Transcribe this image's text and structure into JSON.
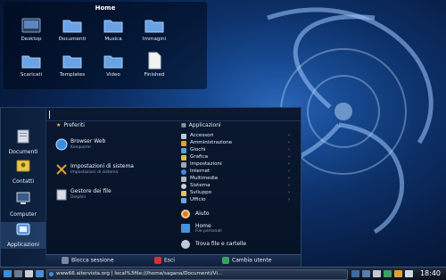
{
  "desktop": {
    "title": "Home",
    "items": [
      {
        "label": "Desktop",
        "icon": "desktop-folder-icon"
      },
      {
        "label": "Documenti",
        "icon": "folder-icon"
      },
      {
        "label": "Musica",
        "icon": "folder-icon"
      },
      {
        "label": "Immagini",
        "icon": "folder-icon"
      },
      {
        "label": "Scaricati",
        "icon": "folder-icon"
      },
      {
        "label": "Templates",
        "icon": "folder-icon"
      },
      {
        "label": "Video",
        "icon": "folder-icon"
      },
      {
        "label": "Finished",
        "icon": "file-icon"
      }
    ]
  },
  "launcher": {
    "sidebar": [
      {
        "label": "Documenti",
        "icon": "documents-icon"
      },
      {
        "label": "Contatti",
        "icon": "contacts-icon"
      },
      {
        "label": "Computer",
        "icon": "computer-icon"
      },
      {
        "label": "Applicazioni",
        "icon": "applications-icon"
      }
    ],
    "favorites_header": "Preferiti",
    "applications_header": "Applicazioni",
    "favorites": [
      {
        "title": "Browser Web",
        "subtitle": "Konqueror",
        "icon": "web-browser-icon"
      },
      {
        "title": "Impostazioni di sistema",
        "subtitle": "Impostazioni di sistema",
        "icon": "settings-icon"
      },
      {
        "title": "Gestore dei file",
        "subtitle": "Dolphin",
        "icon": "file-manager-icon"
      }
    ],
    "categories": [
      {
        "label": "Accessori",
        "color": "#c0c8d4"
      },
      {
        "label": "Amministrazione",
        "color": "#e0a030"
      },
      {
        "label": "Giochi",
        "color": "#5aa0e0"
      },
      {
        "label": "Grafica",
        "color": "#d8c040"
      },
      {
        "label": "Impostazioni",
        "color": "#9fa8b4"
      },
      {
        "label": "Internet",
        "color": "#3a8ee0"
      },
      {
        "label": "Multimedia",
        "color": "#b0b8c4"
      },
      {
        "label": "Sistema",
        "color": "#c8d0da"
      },
      {
        "label": "Sviluppo",
        "color": "#e0c060"
      },
      {
        "label": "Ufficio",
        "color": "#6aa8e8"
      }
    ],
    "arrow": "›",
    "extra": [
      {
        "title": "Aiuto",
        "subtitle": "",
        "icon": "help-icon",
        "color": "#e07a20"
      },
      {
        "title": "Home",
        "subtitle": "File personali",
        "icon": "home-icon",
        "color": "#4a90d8"
      },
      {
        "title": "Trova file e cartelle",
        "subtitle": "",
        "icon": "find-icon",
        "color": "#c0c8d4"
      }
    ],
    "bottom": {
      "lock": "Blocca sessione",
      "logout": "Esci",
      "switch": "Cambia utente"
    }
  },
  "taskbar": {
    "task_title": "www66.altervista.org | local%3file:///home/sagana/Documenti/Vi...",
    "clock": "18:40"
  },
  "colors": {
    "accent": "#2a66b8",
    "panel": "#0a1830"
  }
}
